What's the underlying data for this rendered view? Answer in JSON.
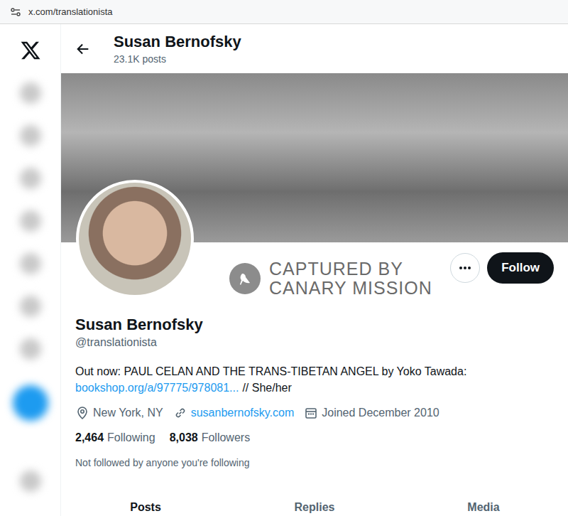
{
  "browser": {
    "url": "x.com/translationista"
  },
  "header": {
    "name": "Susan Bernofsky",
    "posts": "23.1K posts"
  },
  "watermark": {
    "lines": [
      "CAPTURED BY",
      "CANARY MISSION"
    ]
  },
  "actions": {
    "follow": "Follow"
  },
  "profile": {
    "name": "Susan Bernofsky",
    "handle": "@translationista",
    "bio": {
      "text": "Out now: PAUL CELAN AND THE TRANS-TIBETAN ANGEL by Yoko Tawada:",
      "link": "bookshop.org/a/97775/978081...",
      "suffix": "// She/her"
    },
    "meta": [
      {
        "kind": "location",
        "text": "New York, NY"
      },
      {
        "kind": "link",
        "text": "susanbernofsky.com"
      },
      {
        "kind": "joined",
        "text": "Joined December 2010"
      }
    ],
    "stats": [
      {
        "count": "2,464",
        "label": "Following"
      },
      {
        "count": "8,038",
        "label": "Followers"
      }
    ],
    "followed_by": "Not followed by anyone you're following"
  },
  "tabs": [
    {
      "label": "Posts",
      "selected": true
    },
    {
      "label": "Replies",
      "selected": false
    },
    {
      "label": "Media",
      "selected": false
    }
  ]
}
